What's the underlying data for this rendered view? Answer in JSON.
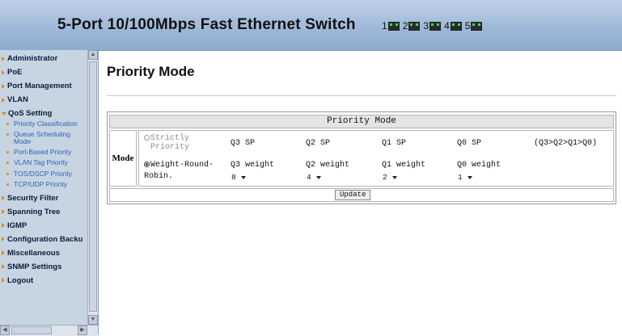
{
  "header": {
    "title": "5-Port 10/100Mbps Fast Ethernet Switch",
    "ports": [
      "1",
      "2",
      "3",
      "4",
      "5"
    ]
  },
  "sidebar": {
    "items": [
      {
        "label": "Administrator",
        "open": false
      },
      {
        "label": "PoE",
        "open": false
      },
      {
        "label": "Port Management",
        "open": false
      },
      {
        "label": "VLAN",
        "open": false
      },
      {
        "label": "QoS Setting",
        "open": true,
        "children": [
          "Priority Classification",
          "Queue Scheduling Mode",
          "Port-Based Priority",
          "VLAN Tag Priority",
          "TOS/DSCP Priority",
          "TCP/UDP Priority"
        ]
      },
      {
        "label": "Security Filter",
        "open": false
      },
      {
        "label": "Spanning Tree",
        "open": false
      },
      {
        "label": "IGMP",
        "open": false
      },
      {
        "label": "Configuration Backu",
        "open": false
      },
      {
        "label": "Miscellaneous",
        "open": false
      },
      {
        "label": "SNMP Settings",
        "open": false
      },
      {
        "label": "Logout",
        "open": false
      }
    ]
  },
  "main": {
    "page_title": "Priority Mode",
    "panel_title": "Priority Mode",
    "mode_label": "Mode",
    "strict": {
      "label": "Strictly Priority",
      "selected": false,
      "queues": [
        "Q3 SP",
        "Q2 SP",
        "Q1 SP",
        "Q0 SP"
      ],
      "order": "(Q3>Q2>Q1>Q0)"
    },
    "wrr": {
      "label_line1": "Weight-Round-",
      "label_line2": "Robin.",
      "selected": true,
      "weights": [
        {
          "label": "Q3 weight",
          "value": "8"
        },
        {
          "label": "Q2 weight",
          "value": "4"
        },
        {
          "label": "Q1 weight",
          "value": "2"
        },
        {
          "label": "Q0 weight",
          "value": "1"
        }
      ]
    },
    "update_label": "Update"
  }
}
